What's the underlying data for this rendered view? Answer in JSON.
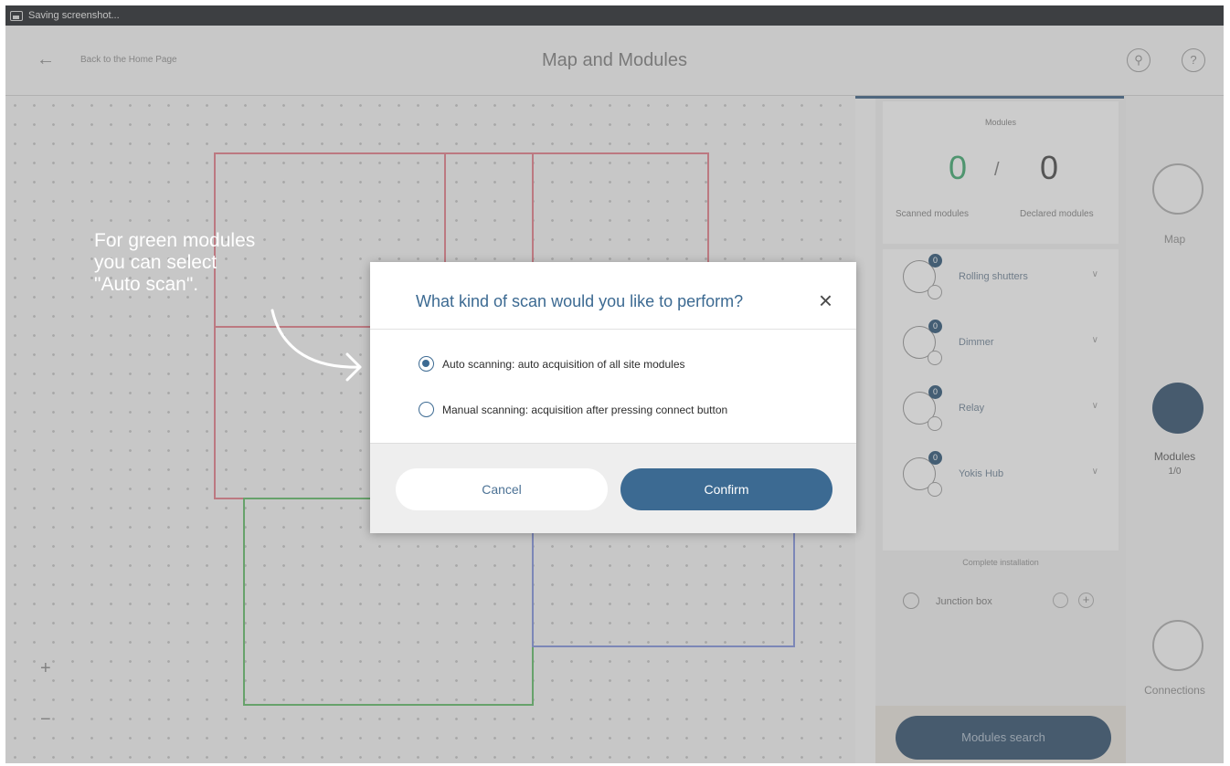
{
  "statusbar": {
    "text": "Saving screenshot..."
  },
  "header": {
    "back_label": "Back to the Home Page",
    "title": "Map and Modules"
  },
  "map": {
    "rooms": [
      {
        "label": "",
        "color": "#e07a86"
      },
      {
        "label": "",
        "color": "#e07a86"
      },
      {
        "label": "",
        "color": "#e07a86"
      },
      {
        "label": "",
        "color": "#e07a86"
      },
      {
        "label": "",
        "color": "#5fb865"
      },
      {
        "label": "",
        "color": "#7f8fd8"
      }
    ],
    "zoom_in": "+",
    "zoom_out": "−"
  },
  "modules_panel": {
    "title": "Modules",
    "scanned_count": "0",
    "separator": "/",
    "declared_count": "0",
    "scanned_label": "Scanned modules",
    "declared_label": "Declared modules",
    "items": [
      {
        "label": "Rolling shutters",
        "badge": "0"
      },
      {
        "label": "Dimmer",
        "badge": "0"
      },
      {
        "label": "Relay",
        "badge": "0"
      },
      {
        "label": "Yokis Hub",
        "badge": "0"
      }
    ],
    "complete_installation": "Complete installation",
    "junction_label": "Junction box",
    "search_button": "Modules search"
  },
  "sidenav": {
    "map_label": "Map",
    "modules_label": "Modules",
    "modules_count": "1/0",
    "connections_label": "Connections"
  },
  "annotation": {
    "line1": "For green modules",
    "line2": "you can select",
    "line3": "\"Auto scan\"."
  },
  "dialog": {
    "title": "What kind of scan would you like to perform?",
    "options": [
      {
        "label": "Auto scanning: auto acquisition of all site modules",
        "selected": true
      },
      {
        "label": "Manual scanning: acquisition after pressing connect button",
        "selected": false
      }
    ],
    "cancel_label": "Cancel",
    "confirm_label": "Confirm"
  },
  "colors": {
    "accent": "#3c6a92",
    "scanned": "#3aa56b",
    "dark_button": "#2e4c69"
  }
}
